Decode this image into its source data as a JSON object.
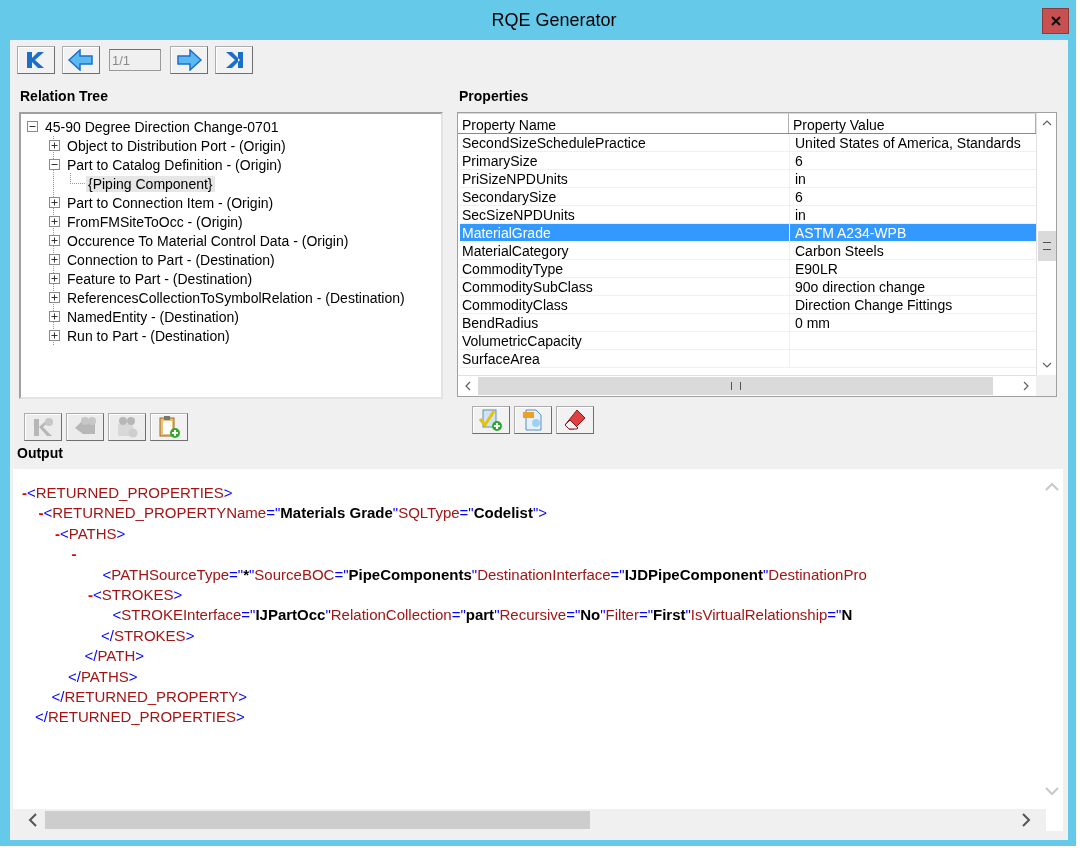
{
  "window": {
    "title": "RQE Generator"
  },
  "nav_buttons": [
    {
      "kind": "first"
    },
    {
      "kind": "previous"
    },
    {
      "kind": "next"
    },
    {
      "kind": "last"
    }
  ],
  "record_field": {
    "value": "1/1",
    "disabled": true
  },
  "relation_tree": {
    "label": "Relation Tree",
    "nodes": [
      {
        "text": "45-90 Degree Direction Change-0701",
        "expanded": true,
        "selected": false,
        "children": [
          {
            "text": "Object to Distribution Port - (Origin)",
            "expanded": false,
            "selected": false
          },
          {
            "text": "Part to Catalog Definition - (Origin)",
            "expanded": true,
            "selected": false,
            "children": [
              {
                "text": "{Piping Component}",
                "selected": true
              }
            ]
          },
          {
            "text": "Part to Connection Item - (Origin)",
            "expanded": false,
            "selected": false
          },
          {
            "text": "FromFMSiteToOcc - (Origin)",
            "expanded": false,
            "selected": false
          },
          {
            "text": "Occurence To Material Control Data - (Origin)",
            "expanded": false,
            "selected": false
          },
          {
            "text": "Connection to Part - (Destination)",
            "expanded": false,
            "selected": false
          },
          {
            "text": "Feature to Part - (Destination)",
            "expanded": false,
            "selected": false
          },
          {
            "text": "ReferencesCollectionToSymbolRelation - (Destination)",
            "expanded": false,
            "selected": false
          },
          {
            "text": "NamedEntity - (Destination)",
            "expanded": false,
            "selected": false
          },
          {
            "text": "Run to Part - (Destination)",
            "expanded": false,
            "selected": false
          }
        ]
      }
    ]
  },
  "tree_toolbar": [
    {
      "kind": "relation",
      "disabled": true
    },
    {
      "kind": "tag",
      "disabled": true
    },
    {
      "kind": "group",
      "disabled": true
    },
    {
      "kind": "clipboard",
      "disabled": false
    }
  ],
  "properties": {
    "label": "Properties",
    "columns": [
      "Property Name",
      "Property Value"
    ],
    "rows": [
      {
        "name": "SecondSizeSchedulePractice",
        "value": "United States of America, Standards",
        "selected": false
      },
      {
        "name": "PrimarySize",
        "value": "6",
        "selected": false
      },
      {
        "name": "PriSizeNPDUnits",
        "value": "in",
        "selected": false
      },
      {
        "name": "SecondarySize",
        "value": "6",
        "selected": false
      },
      {
        "name": "SecSizeNPDUnits",
        "value": "in",
        "selected": false
      },
      {
        "name": "MaterialGrade",
        "value": "ASTM A234-WPB",
        "selected": true
      },
      {
        "name": "MaterialCategory",
        "value": "Carbon Steels",
        "selected": false
      },
      {
        "name": "CommodityType",
        "value": "E90LR",
        "selected": false
      },
      {
        "name": "CommoditySubClass",
        "value": "90o direction change",
        "selected": false
      },
      {
        "name": "CommodityClass",
        "value": "Direction Change Fittings",
        "selected": false
      },
      {
        "name": "BendRadius",
        "value": "0 mm",
        "selected": false
      },
      {
        "name": "VolumetricCapacity",
        "selected": false
      },
      {
        "name": "SurfaceArea",
        "selected": false
      }
    ]
  },
  "properties_toolbar": [
    {
      "kind": "validate",
      "disabled": false
    },
    {
      "kind": "xml",
      "disabled": false
    },
    {
      "kind": "eraser",
      "disabled": false
    }
  ],
  "output": {
    "label": "Output",
    "xml": [
      {
        "toggle": "-",
        "kind": "inline",
        "open": [
          {
            "kind": "punct",
            "text": "<"
          },
          {
            "kind": "name",
            "text": "RETURNED_PROPERTIES"
          },
          {
            "kind": "punct",
            "text": ">"
          }
        ],
        "close": [
          {
            "kind": "punct",
            "text": "</"
          },
          {
            "kind": "name",
            "text": "RETURNED_PROPERTIES"
          },
          {
            "kind": "punct",
            "text": ">"
          }
        ],
        "children": [
          {
            "toggle": "-",
            "kind": "inline",
            "open": [
              {
                "kind": "punct",
                "text": "<"
              },
              {
                "kind": "name",
                "text": "RETURNED_PROPERTYName"
              },
              {
                "kind": "punct",
                "text": "=\""
              },
              {
                "kind": "value",
                "text": "Materials Grade"
              },
              {
                "kind": "punct",
                "text": "\""
              },
              {
                "kind": "name",
                "text": "SQLType"
              },
              {
                "kind": "punct",
                "text": "=\""
              },
              {
                "kind": "value",
                "text": "Codelist"
              },
              {
                "kind": "punct",
                "text": "\">"
              }
            ],
            "close": [
              {
                "kind": "punct",
                "text": "</"
              },
              {
                "kind": "name",
                "text": "RETURNED_PROPERTY"
              },
              {
                "kind": "punct",
                "text": ">"
              }
            ],
            "children": [
              {
                "toggle": "-",
                "kind": "inline",
                "open": [
                  {
                    "kind": "punct",
                    "text": "<"
                  },
                  {
                    "kind": "name",
                    "text": "PATHS"
                  },
                  {
                    "kind": "punct",
                    "text": ">"
                  }
                ],
                "close": [
                  {
                    "kind": "punct",
                    "text": "</"
                  },
                  {
                    "kind": "name",
                    "text": "PATHS"
                  },
                  {
                    "kind": "punct",
                    "text": ">"
                  }
                ],
                "children": [
                  {
                    "toggle": "-",
                    "kind": "wrapped",
                    "open": [
                      {
                        "kind": "punct",
                        "text": "<"
                      },
                      {
                        "kind": "name",
                        "text": "PATHSourceType"
                      },
                      {
                        "kind": "punct",
                        "text": "=\""
                      },
                      {
                        "kind": "value",
                        "text": "*"
                      },
                      {
                        "kind": "punct",
                        "text": "\""
                      },
                      {
                        "kind": "name",
                        "text": "SourceBOC"
                      },
                      {
                        "kind": "punct",
                        "text": "=\""
                      },
                      {
                        "kind": "value",
                        "text": "PipeComponents"
                      },
                      {
                        "kind": "punct",
                        "text": "\""
                      },
                      {
                        "kind": "name",
                        "text": "DestinationInterface"
                      },
                      {
                        "kind": "punct",
                        "text": "=\""
                      },
                      {
                        "kind": "value",
                        "text": "IJDPipeComponent"
                      },
                      {
                        "kind": "punct",
                        "text": "\""
                      },
                      {
                        "kind": "name",
                        "text": "DestinationPro"
                      }
                    ],
                    "close": [
                      {
                        "kind": "punct",
                        "text": "</"
                      },
                      {
                        "kind": "name",
                        "text": "PATH"
                      },
                      {
                        "kind": "punct",
                        "text": ">"
                      }
                    ],
                    "children": [
                      {
                        "toggle": "-",
                        "kind": "inline",
                        "open": [
                          {
                            "kind": "punct",
                            "text": "<"
                          },
                          {
                            "kind": "name",
                            "text": "STROKES"
                          },
                          {
                            "kind": "punct",
                            "text": ">"
                          }
                        ],
                        "close": [
                          {
                            "kind": "punct",
                            "text": "</"
                          },
                          {
                            "kind": "name",
                            "text": "STROKES"
                          },
                          {
                            "kind": "punct",
                            "text": ">"
                          }
                        ],
                        "children": [
                          {
                            "kind": "inline",
                            "open": [
                              {
                                "kind": "punct",
                                "text": "<"
                              },
                              {
                                "kind": "name",
                                "text": "STROKEInterface"
                              },
                              {
                                "kind": "punct",
                                "text": "=\""
                              },
                              {
                                "kind": "value",
                                "text": "IJPartOcc"
                              },
                              {
                                "kind": "punct",
                                "text": "\""
                              },
                              {
                                "kind": "name",
                                "text": "RelationCollection"
                              },
                              {
                                "kind": "punct",
                                "text": "=\""
                              },
                              {
                                "kind": "value",
                                "text": "part"
                              },
                              {
                                "kind": "punct",
                                "text": "\""
                              },
                              {
                                "kind": "name",
                                "text": "Recursive"
                              },
                              {
                                "kind": "punct",
                                "text": "=\""
                              },
                              {
                                "kind": "value",
                                "text": "No"
                              },
                              {
                                "kind": "punct",
                                "text": "\""
                              },
                              {
                                "kind": "name",
                                "text": "Filter"
                              },
                              {
                                "kind": "punct",
                                "text": "=\""
                              },
                              {
                                "kind": "value",
                                "text": "First"
                              },
                              {
                                "kind": "punct",
                                "text": "\""
                              },
                              {
                                "kind": "name",
                                "text": "IsVirtualRelationship"
                              },
                              {
                                "kind": "punct",
                                "text": "=\""
                              },
                              {
                                "kind": "value",
                                "text": "N"
                              }
                            ]
                          }
                        ]
                      }
                    ]
                  }
                ]
              }
            ]
          }
        ]
      }
    ]
  }
}
